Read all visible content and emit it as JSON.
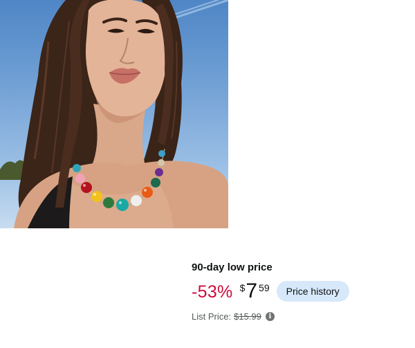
{
  "product": {
    "image_alt": "Woman wearing a multicolor beaded necklace"
  },
  "deal": {
    "badge": "90-day low price"
  },
  "price": {
    "savings": "-53%",
    "currency_symbol": "$",
    "whole": "7",
    "fraction": "59",
    "history_button": "Price history"
  },
  "list_price": {
    "label": "List Price:",
    "value": "$15.99"
  },
  "icons": {
    "info": "info-icon"
  },
  "colors": {
    "savings": "#cc0c39",
    "history_button_bg": "#d7e8fb",
    "secondary_text": "#565959"
  }
}
